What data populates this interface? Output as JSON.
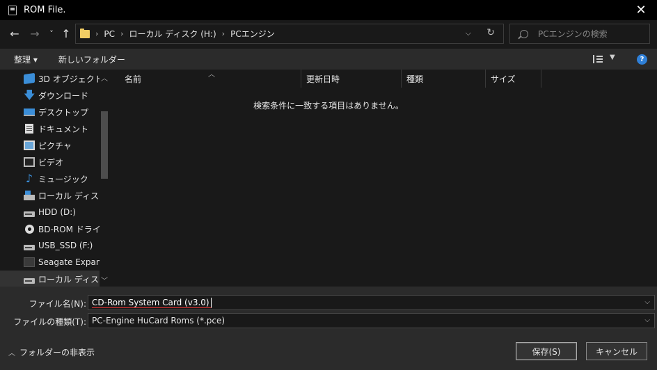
{
  "window": {
    "title": "ROM File."
  },
  "nav": {
    "back": "←",
    "forward": "→",
    "recent": "˅",
    "up": "↑"
  },
  "breadcrumb": [
    "PC",
    "ローカル ディスク (H:)",
    "PCエンジン"
  ],
  "search": {
    "placeholder": "PCエンジンの検索"
  },
  "toolbar": {
    "organize": "整理 ▾",
    "new_folder": "新しいフォルダー"
  },
  "sidebar": {
    "items": [
      {
        "label": "3D オブジェクト",
        "icon": "3d-objects-icon"
      },
      {
        "label": "ダウンロード",
        "icon": "download-icon"
      },
      {
        "label": "デスクトップ",
        "icon": "desktop-icon"
      },
      {
        "label": "ドキュメント",
        "icon": "documents-icon"
      },
      {
        "label": "ピクチャ",
        "icon": "pictures-icon"
      },
      {
        "label": "ビデオ",
        "icon": "videos-icon"
      },
      {
        "label": "ミュージック",
        "icon": "music-icon"
      },
      {
        "label": "ローカル ディスク (C",
        "icon": "windows-drive-icon"
      },
      {
        "label": "HDD (D:)",
        "icon": "drive-icon"
      },
      {
        "label": "BD-ROM ドライブ",
        "icon": "disc-drive-icon"
      },
      {
        "label": "USB_SSD (F:)",
        "icon": "drive-icon"
      },
      {
        "label": "Seagate Expansi",
        "icon": "external-drive-icon"
      },
      {
        "label": "ローカル ディスク (H",
        "icon": "drive-icon"
      }
    ]
  },
  "columns": [
    "名前",
    "更新日時",
    "種類",
    "サイズ"
  ],
  "empty_message": "検索条件に一致する項目はありません。",
  "bottom": {
    "filename_label": "ファイル名(N):",
    "filename_value": "CD-Rom System Card (v3.0)",
    "filetype_label": "ファイルの種類(T):",
    "filetype_value": "PC-Engine HuCard Roms (*.pce)",
    "hide_folders": "フォルダーの非表示",
    "save_button": "保存(S)",
    "cancel_button": "キャンセル"
  },
  "colors": {
    "accent": "#2f80d8",
    "folder": "#f2cd64",
    "underline": "#d33333"
  }
}
